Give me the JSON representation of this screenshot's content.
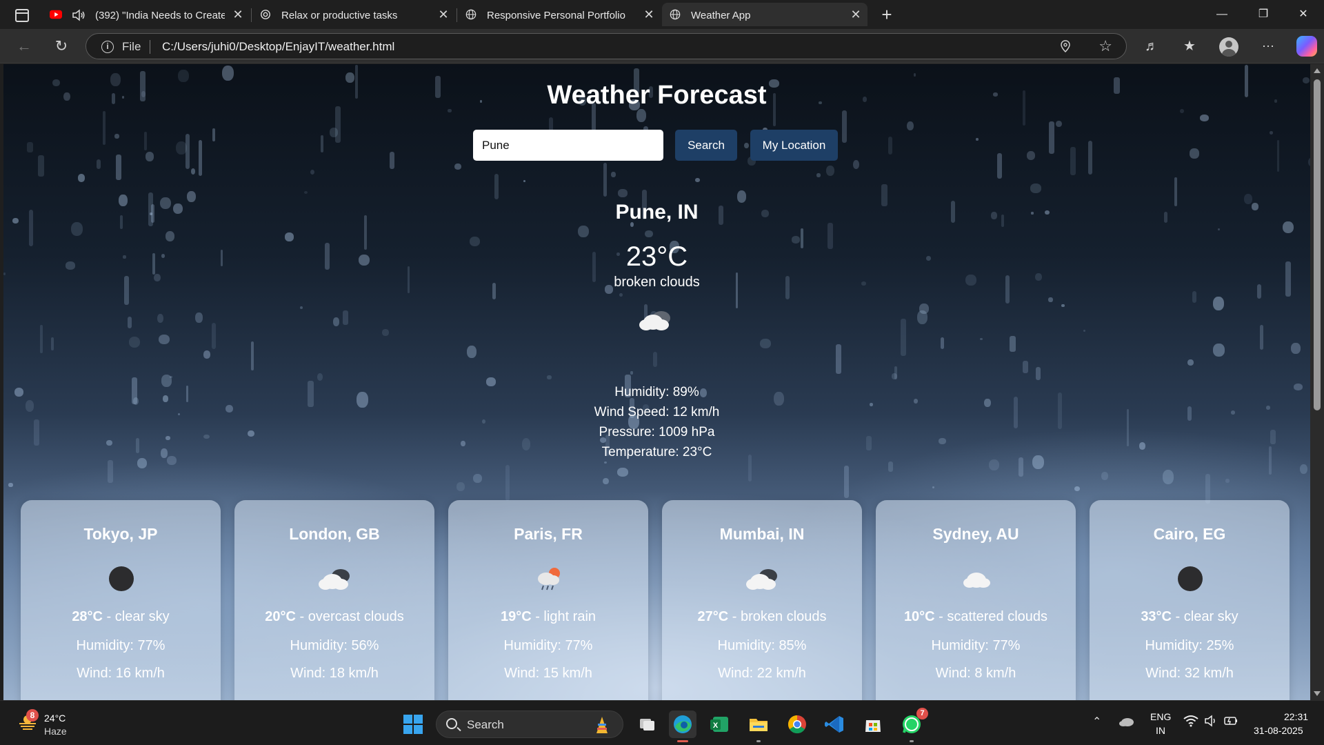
{
  "browser": {
    "tabs": [
      {
        "title": "(392) \"India Needs to Create",
        "favicon": "youtube-icon",
        "audio": "speaker-icon"
      },
      {
        "title": "Relax or productive tasks",
        "favicon": "openai-icon"
      },
      {
        "title": "Responsive Personal Portfolio",
        "favicon": "globe-icon"
      },
      {
        "title": "Weather App",
        "favicon": "globe-icon"
      }
    ],
    "new_tab": "+",
    "close_glyph": "✕",
    "address": {
      "scheme": "File",
      "url": "C:/Users/juhi0/Desktop/EnjayIT/weather.html"
    }
  },
  "app": {
    "title": "Weather Forecast",
    "search": {
      "value": "Pune",
      "button": "Search",
      "location_button": "My Location"
    },
    "current": {
      "city": "Pune, IN",
      "temperature": "23°C",
      "description": "broken clouds",
      "icon": "broken-clouds-icon",
      "humidity": "Humidity: 89%",
      "wind": "Wind Speed: 12 km/h",
      "pressure": "Pressure: 1009 hPa",
      "temp_line": "Temperature: 23°C"
    },
    "cities": [
      {
        "city": "Tokyo, JP",
        "temp": "28°C",
        "desc": " - clear sky",
        "humidity": "Humidity: 77%",
        "wind": "Wind: 16 km/h",
        "icon": "clear-night-icon"
      },
      {
        "city": "London, GB",
        "temp": "20°C",
        "desc": " - overcast clouds",
        "humidity": "Humidity: 56%",
        "wind": "Wind: 18 km/h",
        "icon": "overcast-clouds-icon"
      },
      {
        "city": "Paris, FR",
        "temp": "19°C",
        "desc": " - light rain",
        "humidity": "Humidity: 77%",
        "wind": "Wind: 15 km/h",
        "icon": "light-rain-icon"
      },
      {
        "city": "Mumbai, IN",
        "temp": "27°C",
        "desc": " - broken clouds",
        "humidity": "Humidity: 85%",
        "wind": "Wind: 22 km/h",
        "icon": "broken-clouds-icon"
      },
      {
        "city": "Sydney, AU",
        "temp": "10°C",
        "desc": " - scattered clouds",
        "humidity": "Humidity: 77%",
        "wind": "Wind: 8 km/h",
        "icon": "scattered-clouds-icon"
      },
      {
        "city": "Cairo, EG",
        "temp": "33°C",
        "desc": " - clear sky",
        "humidity": "Humidity: 25%",
        "wind": "Wind: 32 km/h",
        "icon": "clear-night-icon"
      }
    ],
    "colors": {
      "button": "#1e3f66",
      "card": "rgba(215,228,242,0.55)"
    }
  },
  "taskbar": {
    "weather": {
      "temp": "24°C",
      "desc": "Haze",
      "badge": "8"
    },
    "search_label": "Search",
    "whatsapp_badge": "7",
    "lang": {
      "line1": "ENG",
      "line2": "IN"
    },
    "clock": {
      "time": "22:31",
      "date": "31-08-2025"
    }
  }
}
